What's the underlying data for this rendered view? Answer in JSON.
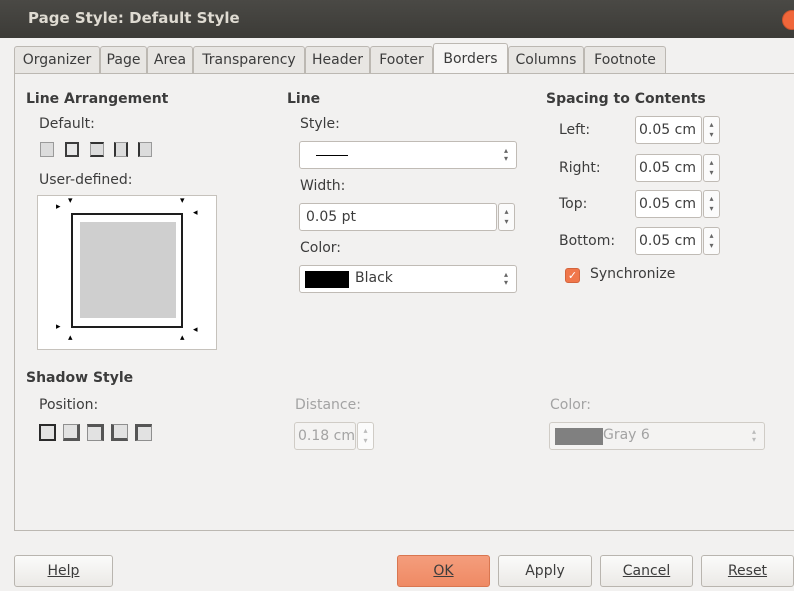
{
  "window": {
    "title": "Page Style: Default Style"
  },
  "tabs": [
    {
      "label": "Organizer",
      "active": false
    },
    {
      "label": "Page",
      "active": false
    },
    {
      "label": "Area",
      "active": false
    },
    {
      "label": "Transparency",
      "active": false
    },
    {
      "label": "Header",
      "active": false
    },
    {
      "label": "Footer",
      "active": false
    },
    {
      "label": "Borders",
      "active": true
    },
    {
      "label": "Columns",
      "active": false
    },
    {
      "label": "Footnote",
      "active": false
    }
  ],
  "line_arrangement": {
    "heading": "Line Arrangement",
    "default_label": "Default:",
    "user_defined_label": "User-defined:"
  },
  "line": {
    "heading": "Line",
    "style_label": "Style:",
    "width_label": "Width:",
    "width_value": "0.05 pt",
    "color_label": "Color:",
    "color_value": "Black",
    "color_swatch": "#000000"
  },
  "spacing": {
    "heading": "Spacing to Contents",
    "left_label": "Left:",
    "left_value": "0.05 cm",
    "right_label": "Right:",
    "right_value": "0.05 cm",
    "top_label": "Top:",
    "top_value": "0.05 cm",
    "bottom_label": "Bottom:",
    "bottom_value": "0.05 cm",
    "synchronize_label": "Synchronize",
    "synchronize_checked": true
  },
  "shadow": {
    "heading": "Shadow Style",
    "position_label": "Position:",
    "distance_label": "Distance:",
    "distance_value": "0.18 cm",
    "color_label": "Color:",
    "color_value": "Gray 6",
    "color_swatch": "#808080"
  },
  "buttons": {
    "help": "Help",
    "ok": "OK",
    "apply": "Apply",
    "cancel": "Cancel",
    "reset": "Reset"
  },
  "colors": {
    "accent": "#f0774b",
    "titlebar": "#3c3b37"
  }
}
